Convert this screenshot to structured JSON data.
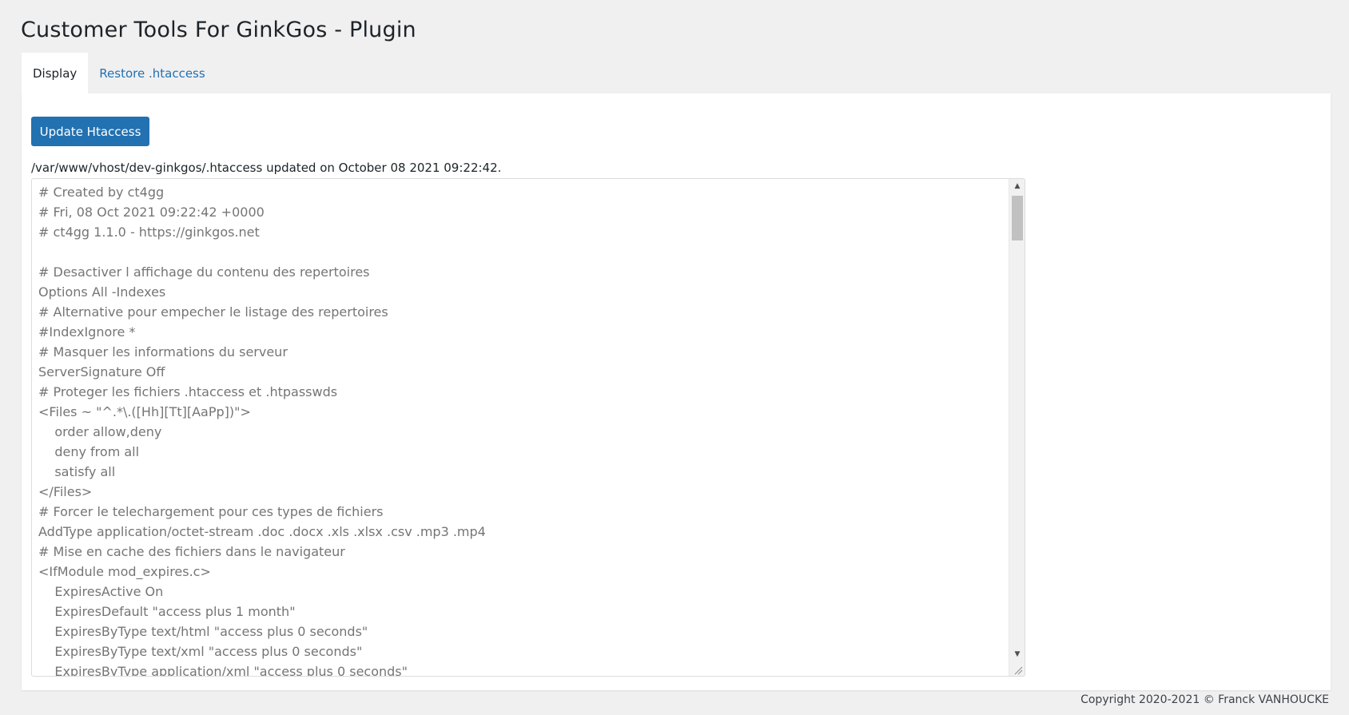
{
  "page": {
    "title": "Customer Tools For GinkGos - Plugin"
  },
  "tabs": [
    {
      "label": "Display",
      "active": true
    },
    {
      "label": "Restore .htaccess",
      "active": false
    }
  ],
  "toolbar": {
    "update_label": "Update Htaccess"
  },
  "status": {
    "message": "/var/www/vhost/dev-ginkgos/.htaccess updated on October 08 2021 09:22:42."
  },
  "editor": {
    "content": "# Created by ct4gg\n# Fri, 08 Oct 2021 09:22:42 +0000\n# ct4gg 1.1.0 - https://ginkgos.net\n\n# Desactiver l affichage du contenu des repertoires\nOptions All -Indexes\n# Alternative pour empecher le listage des repertoires\n#IndexIgnore *\n# Masquer les informations du serveur\nServerSignature Off\n# Proteger les fichiers .htaccess et .htpasswds\n<Files ~ \"^.*\\.([Hh][Tt][AaPp])\">\n\torder allow,deny\n\tdeny from all\n\tsatisfy all\n</Files>\n# Forcer le telechargement pour ces types de fichiers\nAddType application/octet-stream .doc .docx .xls .xlsx .csv .mp3 .mp4\n# Mise en cache des fichiers dans le navigateur\n<IfModule mod_expires.c>\n\tExpiresActive On\n\tExpiresDefault \"access plus 1 month\"\n\tExpiresByType text/html \"access plus 0 seconds\"\n\tExpiresByType text/xml \"access plus 0 seconds\"\n\tExpiresByType application/xml \"access plus 0 seconds\""
  },
  "footer": {
    "copyright": "Copyright 2020-2021 © Franck VANHOUCKE"
  },
  "colors": {
    "background": "#f0f0f1",
    "panel": "#ffffff",
    "primary_button": "#2271b1",
    "link": "#2271b1",
    "editor_text": "#757575"
  },
  "icons": {
    "scroll_up": "triangle-up-icon",
    "scroll_down": "triangle-down-icon",
    "resize": "resize-grip-icon"
  }
}
